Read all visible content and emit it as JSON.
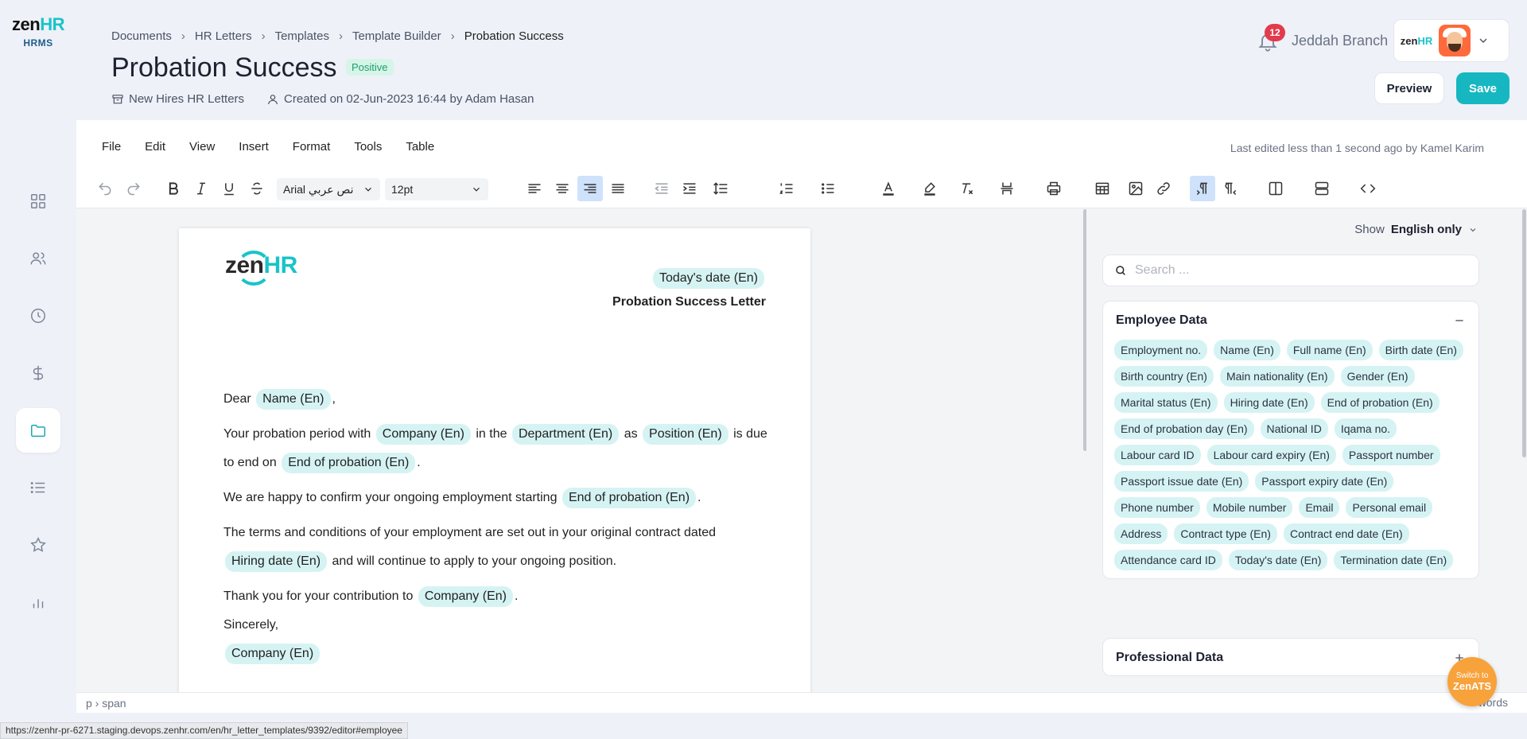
{
  "brand": {
    "logo_zen": "zen",
    "logo_hr": "HR",
    "sub": "HRMS"
  },
  "breadcrumb": [
    "Documents",
    "HR Letters",
    "Templates",
    "Template Builder",
    "Probation Success"
  ],
  "page": {
    "title": "Probation Success",
    "badge": "Positive",
    "category": "New Hires HR Letters",
    "created": "Created on 02-Jun-2023 16:44 by Adam Hasan"
  },
  "header": {
    "notifications": "12",
    "branch": "Jeddah Branch"
  },
  "actions": {
    "preview": "Preview",
    "save": "Save"
  },
  "menubar": [
    "File",
    "Edit",
    "View",
    "Insert",
    "Format",
    "Tools",
    "Table"
  ],
  "last_edited": "Last edited less than 1 second ago by Kamel Karim",
  "toolbar": {
    "font": "Arial نص عربي",
    "size": "12pt"
  },
  "letter": {
    "today_tag": "Today's date (En)",
    "title": "Probation Success Letter",
    "dear": "Dear",
    "name_tag": "Name (En)",
    "comma": ",",
    "p1_a": "Your probation period with",
    "company_tag": "Company (En)",
    "p1_b": "in the",
    "department_tag": "Department (En)",
    "p1_c": "as",
    "position_tag": "Position (En)",
    "p1_d": "is due to end on",
    "end_tag": "End of probation (En)",
    "period": ".",
    "p2": "We are happy to confirm your ongoing employment starting",
    "p3_a": "The terms and conditions of your employment are set out in your original contract dated",
    "hiring_tag": "Hiring date (En)",
    "p3_b": "and will continue to apply to your ongoing position.",
    "p4": "Thank you for your contribution to",
    "sincerely": "Sincerely,"
  },
  "panel": {
    "show_label": "Show",
    "show_value": "English only",
    "search_placeholder": "Search ...",
    "employee_title": "Employee Data",
    "employee_chips": [
      "Employment no.",
      "Name (En)",
      "Full name (En)",
      "Birth date (En)",
      "Birth country (En)",
      "Main nationality (En)",
      "Gender (En)",
      "Marital status (En)",
      "Hiring date (En)",
      "End of probation (En)",
      "End of probation day (En)",
      "National ID",
      "Iqama no.",
      "Labour card ID",
      "Labour card expiry (En)",
      "Passport number",
      "Passport issue date (En)",
      "Passport expiry date (En)",
      "Phone number",
      "Mobile number",
      "Email",
      "Personal email",
      "Address",
      "Contract type (En)",
      "Contract end date (En)",
      "Attendance card ID",
      "Today's date (En)",
      "Termination date (En)"
    ],
    "professional_title": "Professional Data"
  },
  "status": {
    "path": "p › span",
    "words": "words"
  },
  "url": "https://zenhr-pr-6271.staging.devops.zenhr.com/en/hr_letter_templates/9392/editor#employee",
  "fab": {
    "line1": "Switch to",
    "line2": "ZenATS"
  },
  "colors": {
    "accent": "#17b7c1",
    "chip": "#d6f3f4",
    "badge_bg": "#d6f5e9",
    "badge_text": "#1e9e6e"
  }
}
